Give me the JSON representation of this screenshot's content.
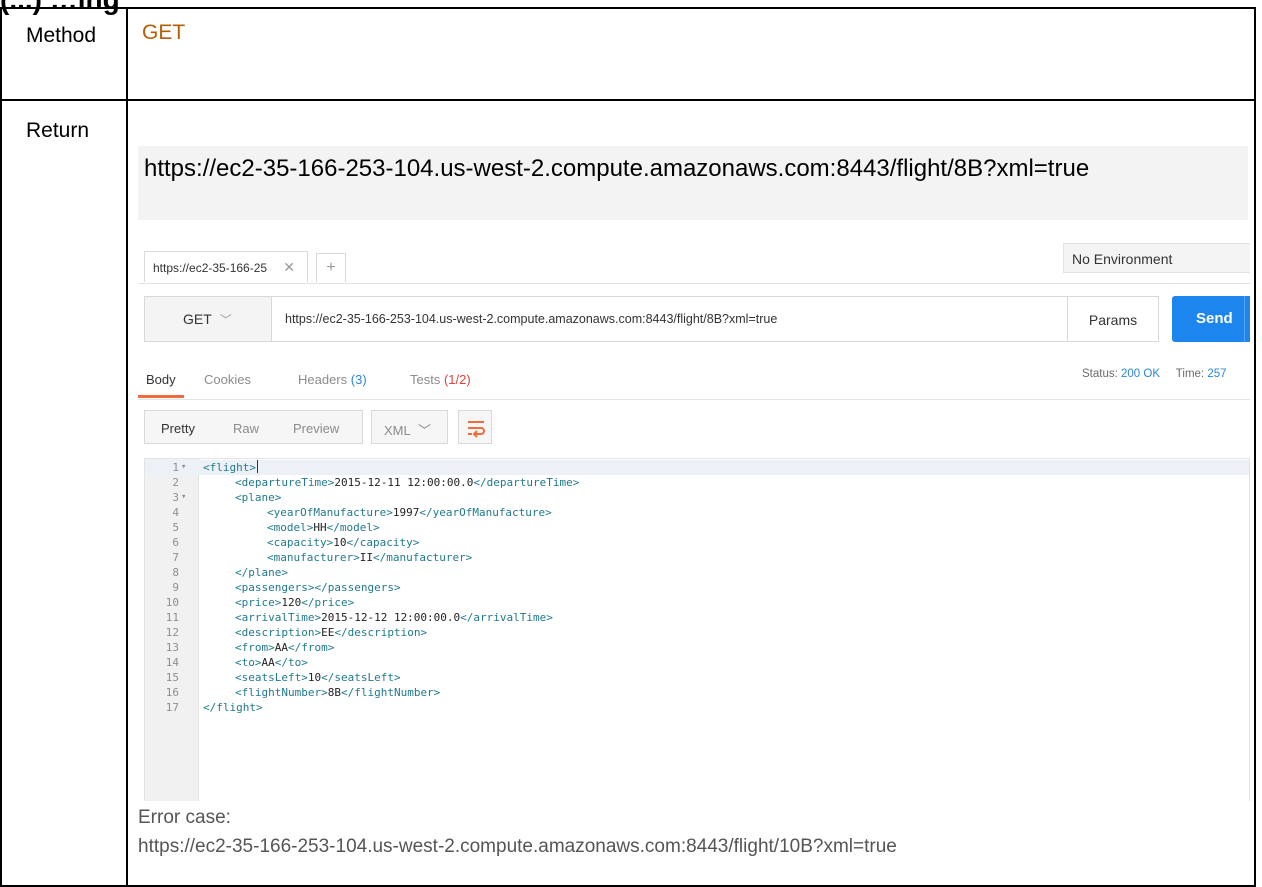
{
  "heading": "(...) …ing",
  "table": {
    "method_label": "Method",
    "method_value": "GET",
    "return_label": "Return",
    "return_url": "https://ec2-35-166-253-104.us-west-2.compute.amazonaws.com:8443/flight/8B?xml=true",
    "error_label": "Error case:",
    "error_url": "https://ec2-35-166-253-104.us-west-2.compute.amazonaws.com:8443/flight/10B?xml=true"
  },
  "postman": {
    "tab_title": "https://ec2-35-166-25",
    "environment": "No Environment",
    "method": "GET",
    "url": "https://ec2-35-166-253-104.us-west-2.compute.amazonaws.com:8443/flight/8B?xml=true",
    "params_label": "Params",
    "send_label": "Send",
    "response_tabs": {
      "body": "Body",
      "cookies": "Cookies",
      "headers": "Headers",
      "headers_count": "(3)",
      "tests": "Tests",
      "tests_count": "(1/2)"
    },
    "status_label": "Status:",
    "status_value": "200 OK",
    "time_label": "Time:",
    "time_value": "257",
    "view_modes": [
      "Pretty",
      "Raw",
      "Preview"
    ],
    "format": "XML",
    "accent_color": "#1c86ee",
    "tab_underline_color": "#f26b3a",
    "code_lines": [
      {
        "n": "1",
        "indent": 0,
        "fold": true,
        "open": "<flight>",
        "text": "",
        "close": ""
      },
      {
        "n": "2",
        "indent": 1,
        "fold": false,
        "open": "<departureTime>",
        "text": "2015-12-11 12:00:00.0",
        "close": "</departureTime>"
      },
      {
        "n": "3",
        "indent": 1,
        "fold": true,
        "open": "<plane>",
        "text": "",
        "close": ""
      },
      {
        "n": "4",
        "indent": 2,
        "fold": false,
        "open": "<yearOfManufacture>",
        "text": "1997",
        "close": "</yearOfManufacture>"
      },
      {
        "n": "5",
        "indent": 2,
        "fold": false,
        "open": "<model>",
        "text": "HH",
        "close": "</model>"
      },
      {
        "n": "6",
        "indent": 2,
        "fold": false,
        "open": "<capacity>",
        "text": "10",
        "close": "</capacity>"
      },
      {
        "n": "7",
        "indent": 2,
        "fold": false,
        "open": "<manufacturer>",
        "text": "II",
        "close": "</manufacturer>"
      },
      {
        "n": "8",
        "indent": 1,
        "fold": false,
        "open": "</plane>",
        "text": "",
        "close": ""
      },
      {
        "n": "9",
        "indent": 1,
        "fold": false,
        "open": "<passengers>",
        "text": "",
        "close": "</passengers>"
      },
      {
        "n": "10",
        "indent": 1,
        "fold": false,
        "open": "<price>",
        "text": "120",
        "close": "</price>"
      },
      {
        "n": "11",
        "indent": 1,
        "fold": false,
        "open": "<arrivalTime>",
        "text": "2015-12-12 12:00:00.0",
        "close": "</arrivalTime>"
      },
      {
        "n": "12",
        "indent": 1,
        "fold": false,
        "open": "<description>",
        "text": "EE",
        "close": "</description>"
      },
      {
        "n": "13",
        "indent": 1,
        "fold": false,
        "open": "<from>",
        "text": "AA",
        "close": "</from>"
      },
      {
        "n": "14",
        "indent": 1,
        "fold": false,
        "open": "<to>",
        "text": "AA",
        "close": "</to>"
      },
      {
        "n": "15",
        "indent": 1,
        "fold": false,
        "open": "<seatsLeft>",
        "text": "10",
        "close": "</seatsLeft>"
      },
      {
        "n": "16",
        "indent": 1,
        "fold": false,
        "open": "<flightNumber>",
        "text": "8B",
        "close": "</flightNumber>"
      },
      {
        "n": "17",
        "indent": 0,
        "fold": false,
        "open": "</flight>",
        "text": "",
        "close": ""
      }
    ]
  }
}
